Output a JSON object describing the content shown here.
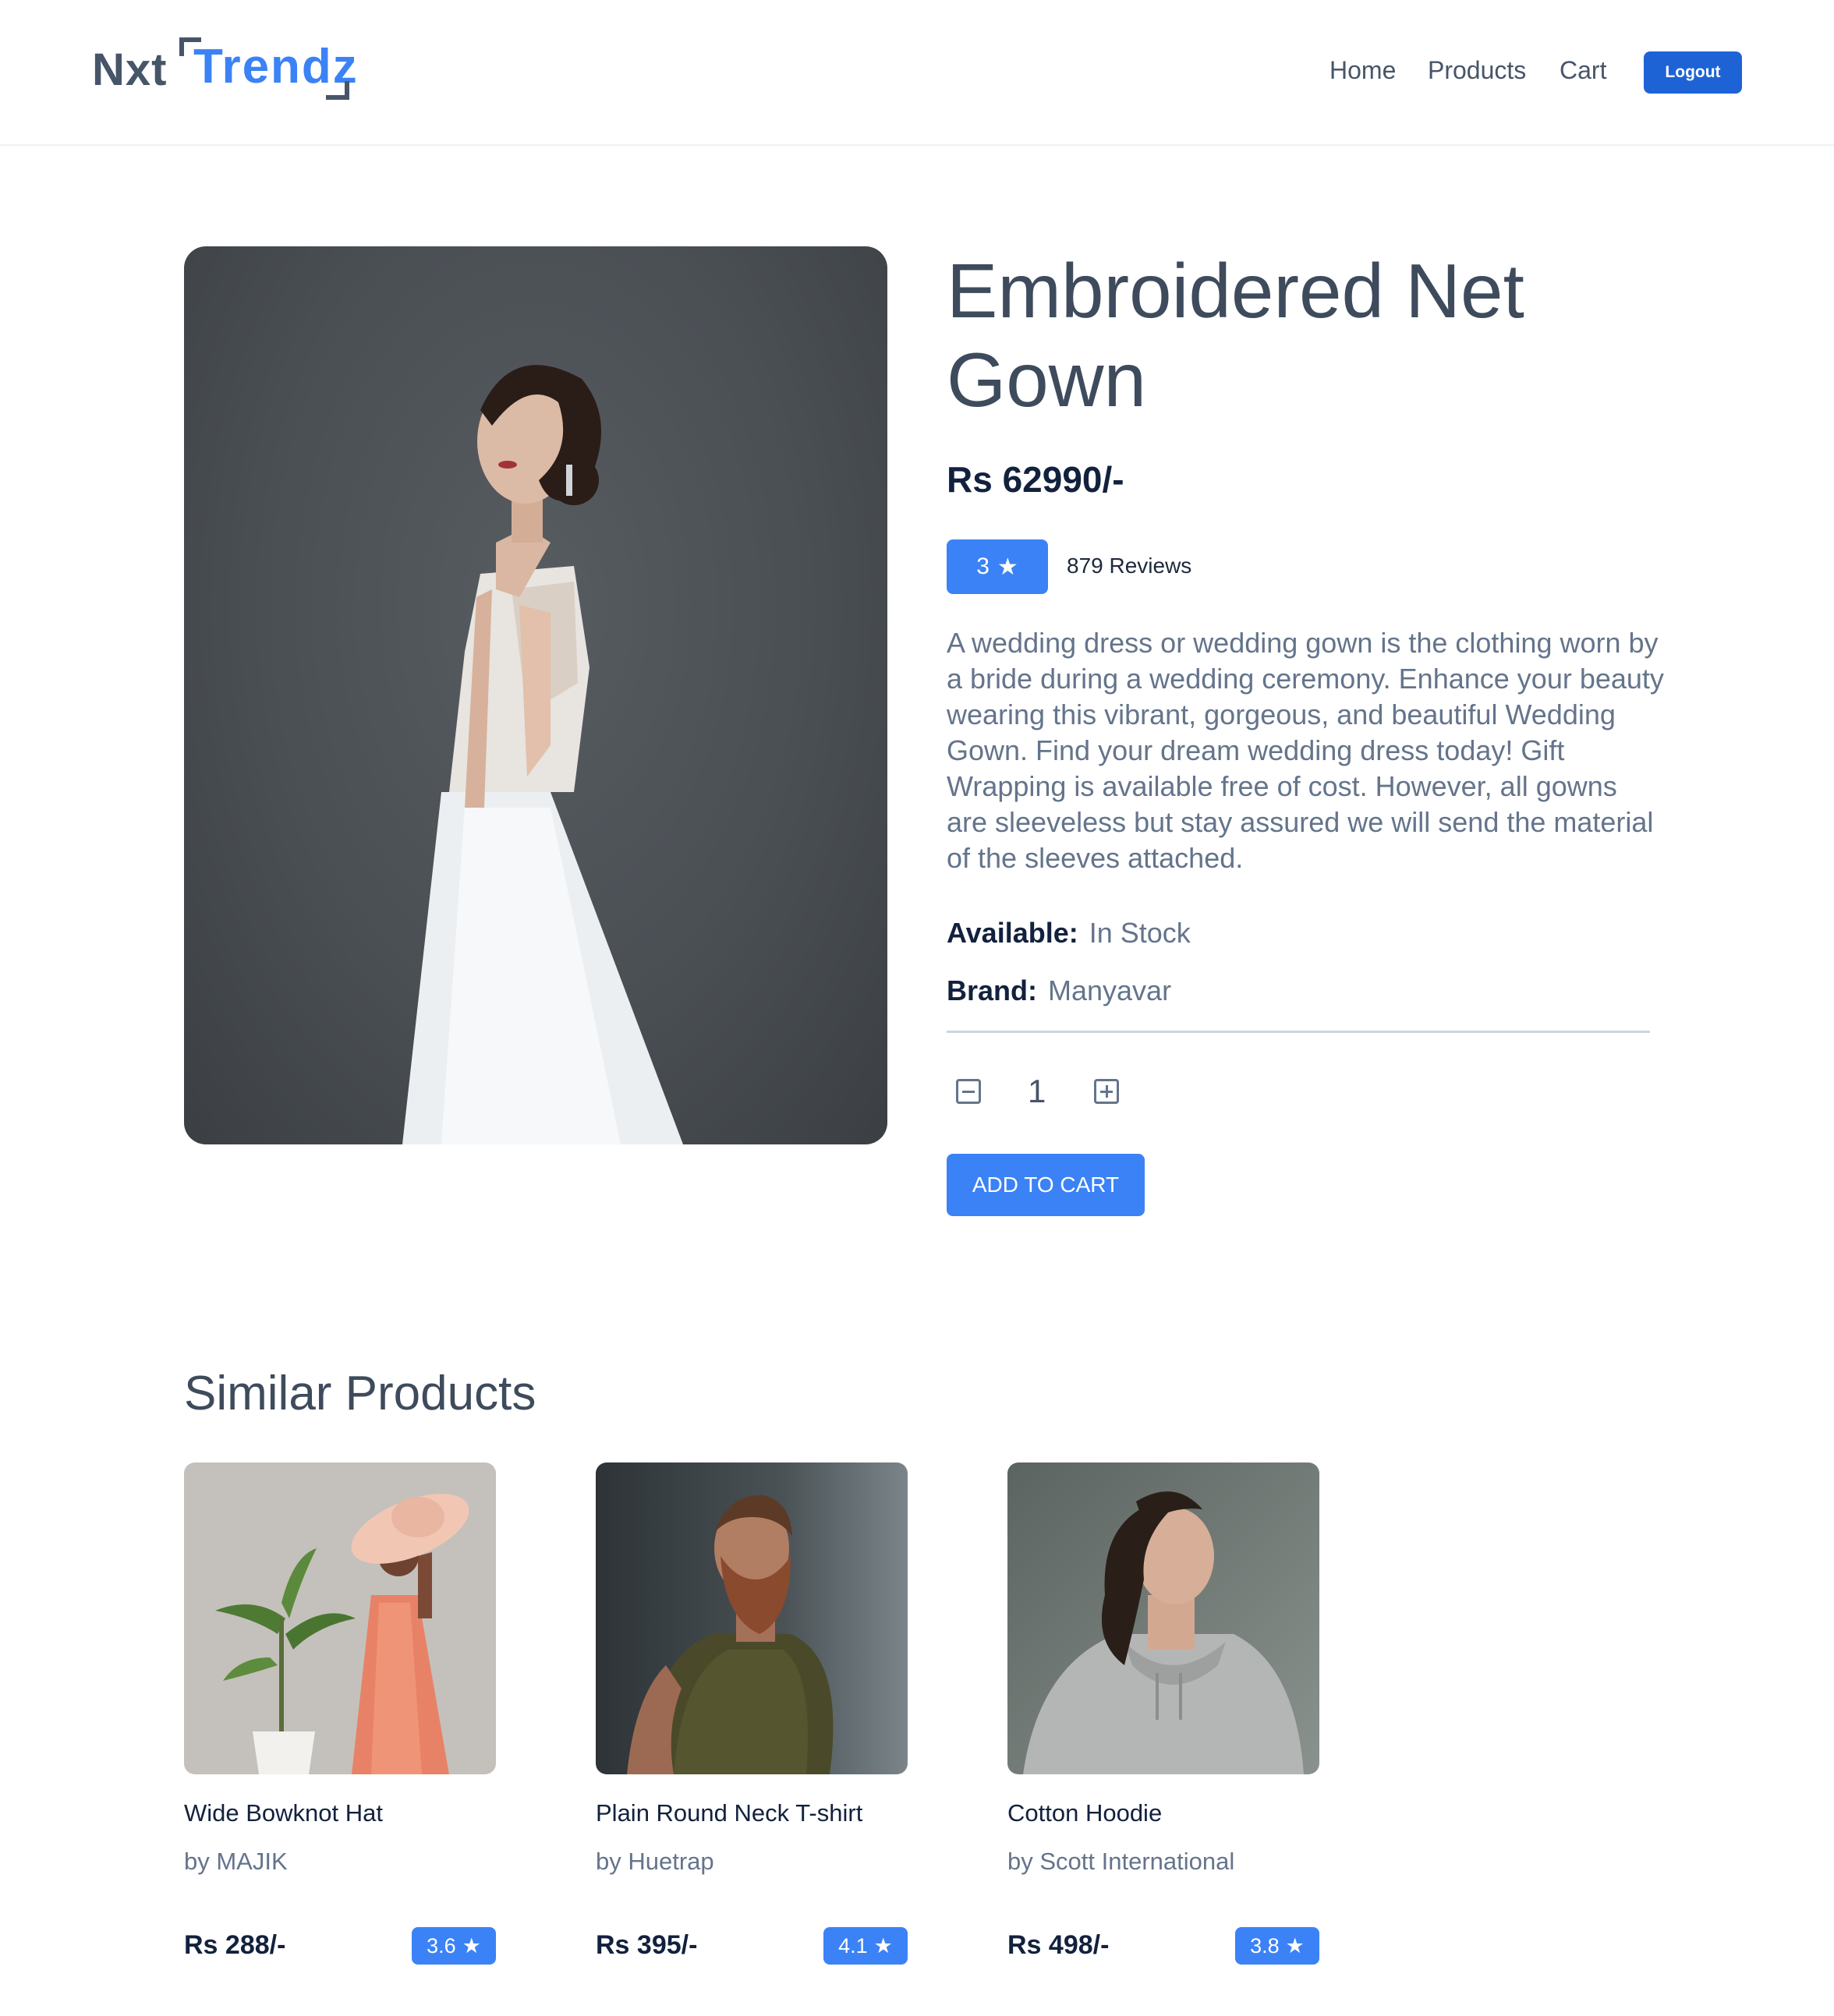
{
  "header": {
    "logo_part1": "Nxt",
    "logo_part2": "Trendz",
    "nav": {
      "home": "Home",
      "products": "Products",
      "cart": "Cart"
    },
    "logout_label": "Logout"
  },
  "product": {
    "image_icon": "wedding-gown-photo",
    "title": "Embroidered Net Gown",
    "price": "Rs 62990/-",
    "rating": "3",
    "rating_star": "★",
    "reviews": "879 Reviews",
    "description": "A wedding dress or wedding gown is the clothing worn by a bride during a wedding ceremony. Enhance your beauty wearing this vibrant, gorgeous, and beautiful Wedding Gown. Find your dream wedding dress today! Gift Wrapping is available free of cost. However, all gowns are sleeveless but stay assured we will send the material of the sleeves attached.",
    "availability_label": "Available:",
    "availability_value": "In Stock",
    "brand_label": "Brand:",
    "brand_value": "Manyavar",
    "quantity": "1",
    "add_to_cart_label": "ADD TO CART"
  },
  "similar": {
    "heading": "Similar Products",
    "items": [
      {
        "title": "Wide Bowknot Hat",
        "brand": "by MAJIK",
        "price": "Rs 288/-",
        "rating": "3.6",
        "star": "★",
        "image_icon": "woman-hat-photo"
      },
      {
        "title": "Plain Round Neck T-shirt",
        "brand": "by Huetrap",
        "price": "Rs 395/-",
        "rating": "4.1",
        "star": "★",
        "image_icon": "bearded-man-photo"
      },
      {
        "title": "Cotton Hoodie",
        "brand": "by Scott International",
        "price": "Rs 498/-",
        "rating": "3.8",
        "star": "★",
        "image_icon": "hoodie-man-photo"
      }
    ]
  },
  "colors": {
    "accent": "#3b82f6",
    "logout": "#1d63d6",
    "heading": "#3e4b5c",
    "price": "#12213d",
    "muted": "#64748b"
  }
}
